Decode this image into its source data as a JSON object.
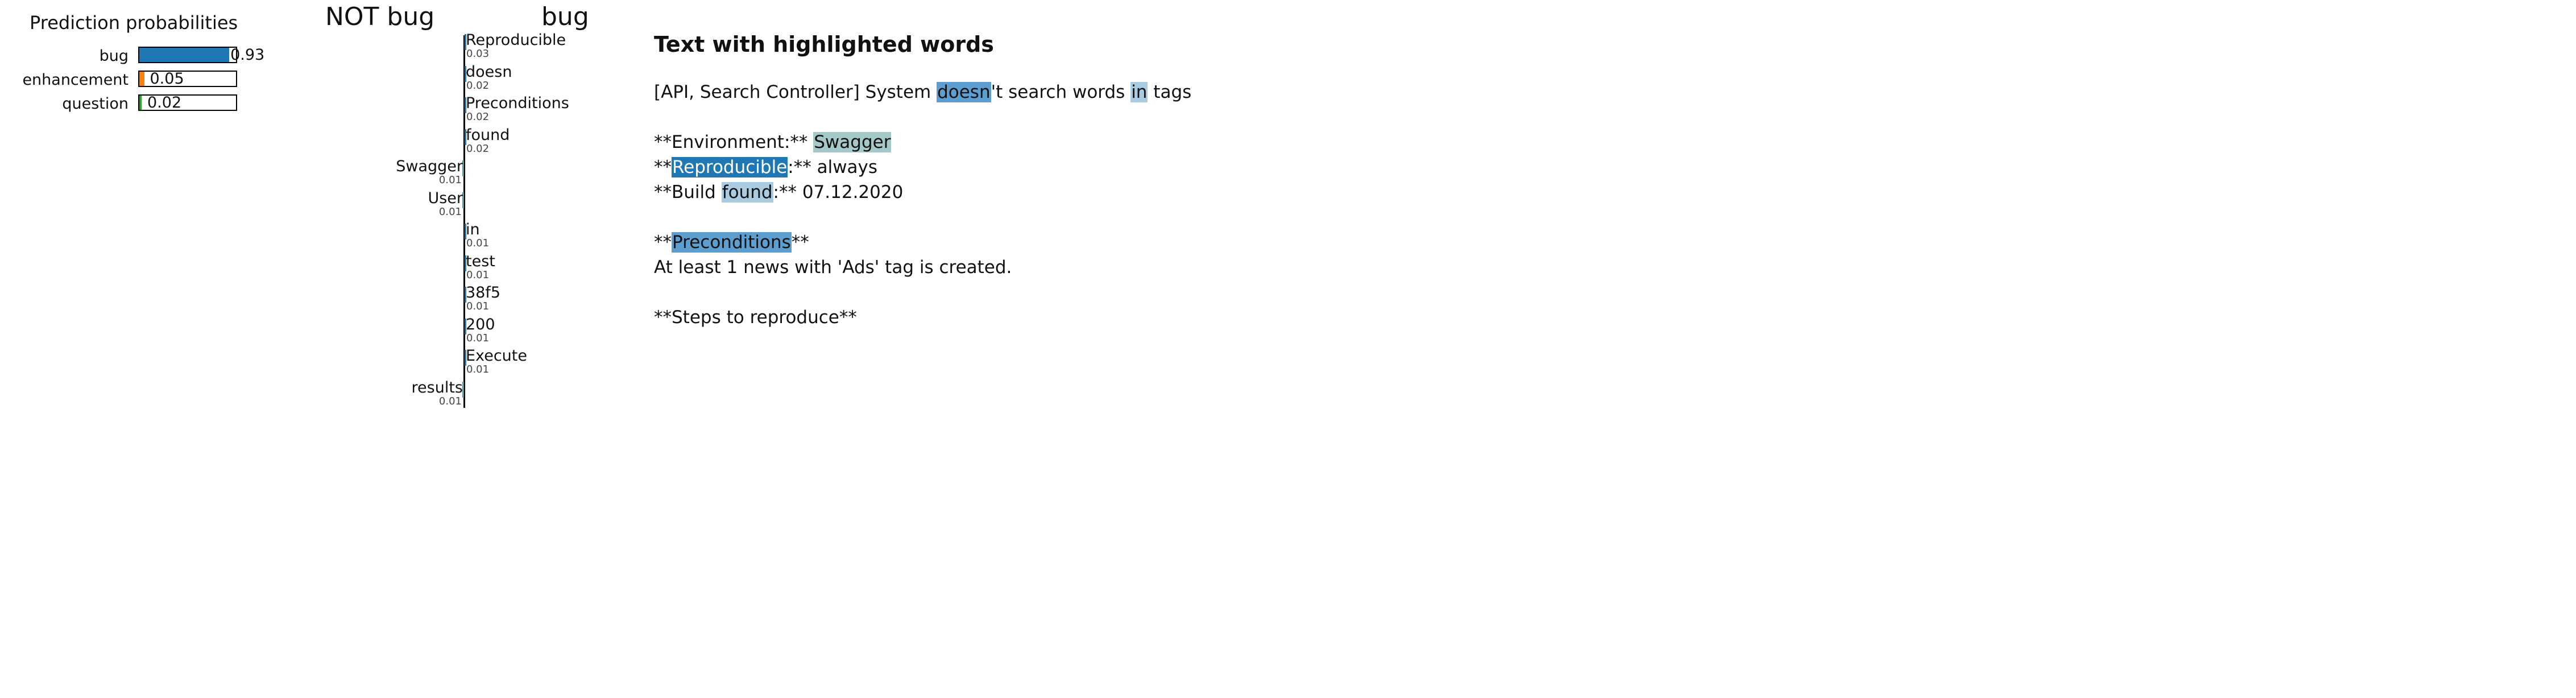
{
  "colors": {
    "bug": "#1f77b4",
    "enhancement": "#ff7f0e",
    "question": "#2ca02c",
    "not_bug_head": "#5a9aa0",
    "bug_head": "#1f77b4",
    "hl_strong": "#1f77b4",
    "hl_medium": "#5b9ecf",
    "hl_light": "#a9cce3",
    "hl_negative": "#a5c8c9"
  },
  "prediction": {
    "title": "Prediction probabilities",
    "rows": [
      {
        "label": "bug",
        "value": 0.93,
        "display": "0.93",
        "color": "#1f77b4"
      },
      {
        "label": "enhancement",
        "value": 0.05,
        "display": "0.05",
        "color": "#ff7f0e"
      },
      {
        "label": "question",
        "value": 0.02,
        "display": "0.02",
        "color": "#2ca02c"
      }
    ]
  },
  "weights": {
    "not_label": "NOT bug",
    "label": "bug"
  },
  "chart_data": {
    "type": "bar",
    "orientation": "horizontal",
    "categories": [
      "Reproducible",
      "doesn",
      "Preconditions",
      "found",
      "Swagger",
      "User",
      "in",
      "test",
      "38f5",
      "200",
      "Execute",
      "results"
    ],
    "values": [
      0.03,
      0.02,
      0.02,
      0.02,
      -0.01,
      -0.01,
      0.01,
      0.01,
      0.01,
      0.01,
      0.01,
      -0.01
    ],
    "value_labels": [
      "0.03",
      "0.02",
      "0.02",
      "0.02",
      "0.01",
      "0.01",
      "0.01",
      "0.01",
      "0.01",
      "0.01",
      "0.01",
      "0.01"
    ],
    "title": "",
    "xlabel": "",
    "ylabel": ""
  },
  "text": {
    "title": "Text with highlighted words",
    "lines": [
      [
        {
          "t": "[API, Search Controller] System "
        },
        {
          "t": "doesn",
          "h": "medium"
        },
        {
          "t": "'t search words "
        },
        {
          "t": "in",
          "h": "light"
        },
        {
          "t": " tags"
        }
      ],
      [],
      [
        {
          "t": "**Environment:** "
        },
        {
          "t": "Swagger",
          "h": "negative"
        }
      ],
      [
        {
          "t": "**"
        },
        {
          "t": "Reproducible",
          "h": "strong"
        },
        {
          "t": ":** always"
        }
      ],
      [
        {
          "t": "**Build "
        },
        {
          "t": "found",
          "h": "light"
        },
        {
          "t": ":** 07.12.2020"
        }
      ],
      [],
      [
        {
          "t": "**"
        },
        {
          "t": "Preconditions",
          "h": "medium"
        },
        {
          "t": "**"
        }
      ],
      [
        {
          "t": "At least 1 news with 'Ads' tag is created."
        }
      ],
      [],
      [
        {
          "t": "**Steps to reproduce**"
        }
      ]
    ]
  }
}
